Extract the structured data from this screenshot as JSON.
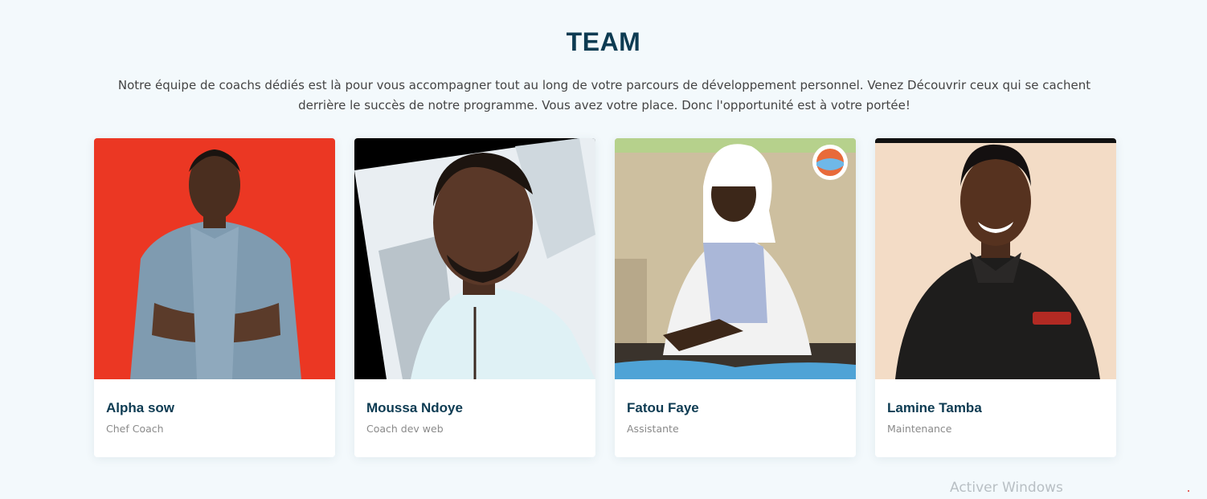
{
  "team": {
    "title": "TEAM",
    "description": "Notre équipe de coachs dédiés est là pour vous accompagner tout au long de votre parcours de développement personnel. Venez Découvrir ceux qui se cachent derrière le succès de notre programme. Vous avez votre place. Donc l'opportunité est à votre portée!",
    "members": [
      {
        "name": "Alpha sow",
        "role": "Chef Coach"
      },
      {
        "name": "Moussa Ndoye",
        "role": "Coach dev web"
      },
      {
        "name": "Fatou Faye",
        "role": "Assistante"
      },
      {
        "name": "Lamine Tamba",
        "role": "Maintenance"
      }
    ]
  },
  "watermark": "Activer Windows"
}
